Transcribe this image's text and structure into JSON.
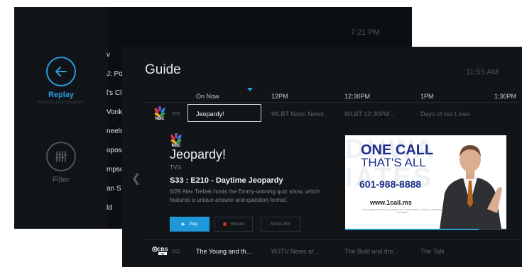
{
  "back_screen": {
    "time": "7:21 PM",
    "sidebar": {
      "replay": {
        "label": "Replay",
        "sublabel": "Recently aired programs"
      },
      "filter": {
        "label": "Filter"
      }
    },
    "rows": [
      "v",
      "J: Po",
      "l's Cl",
      "Vonka",
      "neels",
      "opos",
      "mpso",
      "an S",
      "ld"
    ]
  },
  "guide": {
    "title": "Guide",
    "time": "11:55 AM",
    "timeline": [
      "On Now",
      "12PM",
      "12:30PM",
      "1PM",
      "1:30PM"
    ],
    "channels": [
      {
        "number": "003",
        "logo": "nbc-logo",
        "programs": [
          "Jeopardy!",
          "WLBT Noon News",
          "WLBT 12:30PM...",
          "Days of our Lives"
        ]
      },
      {
        "number": "012",
        "logo": "cbs-logo",
        "programs": [
          "The Young and th...",
          "WJTV News at...",
          "The Bold and the...",
          "The Talk"
        ]
      }
    ],
    "detail": {
      "title": "Jeopardy!",
      "rating": "TVG",
      "episode": "S33 : E210 - Daytime Jeopardy",
      "description": "6/29 Alex Trebek hosts the Emmy-winning quiz show, which features a unique answer-and-question format.",
      "buttons": {
        "play": "Play",
        "record": "Record",
        "series": "Series Info"
      },
      "preview": {
        "bg_text": "DHWA\nIATES",
        "line1": "ONE CALL",
        "line2": "THAT'S ALL",
        "phone": "601-988-8888",
        "url": "www.1call.ms",
        "fine": "Free background information available upon request Offices in Jackson, Hattiesburg and Tupelo"
      },
      "progress": 0.83
    }
  },
  "colors": {
    "accent": "#2a9bd8",
    "record": "#e02d2d"
  }
}
